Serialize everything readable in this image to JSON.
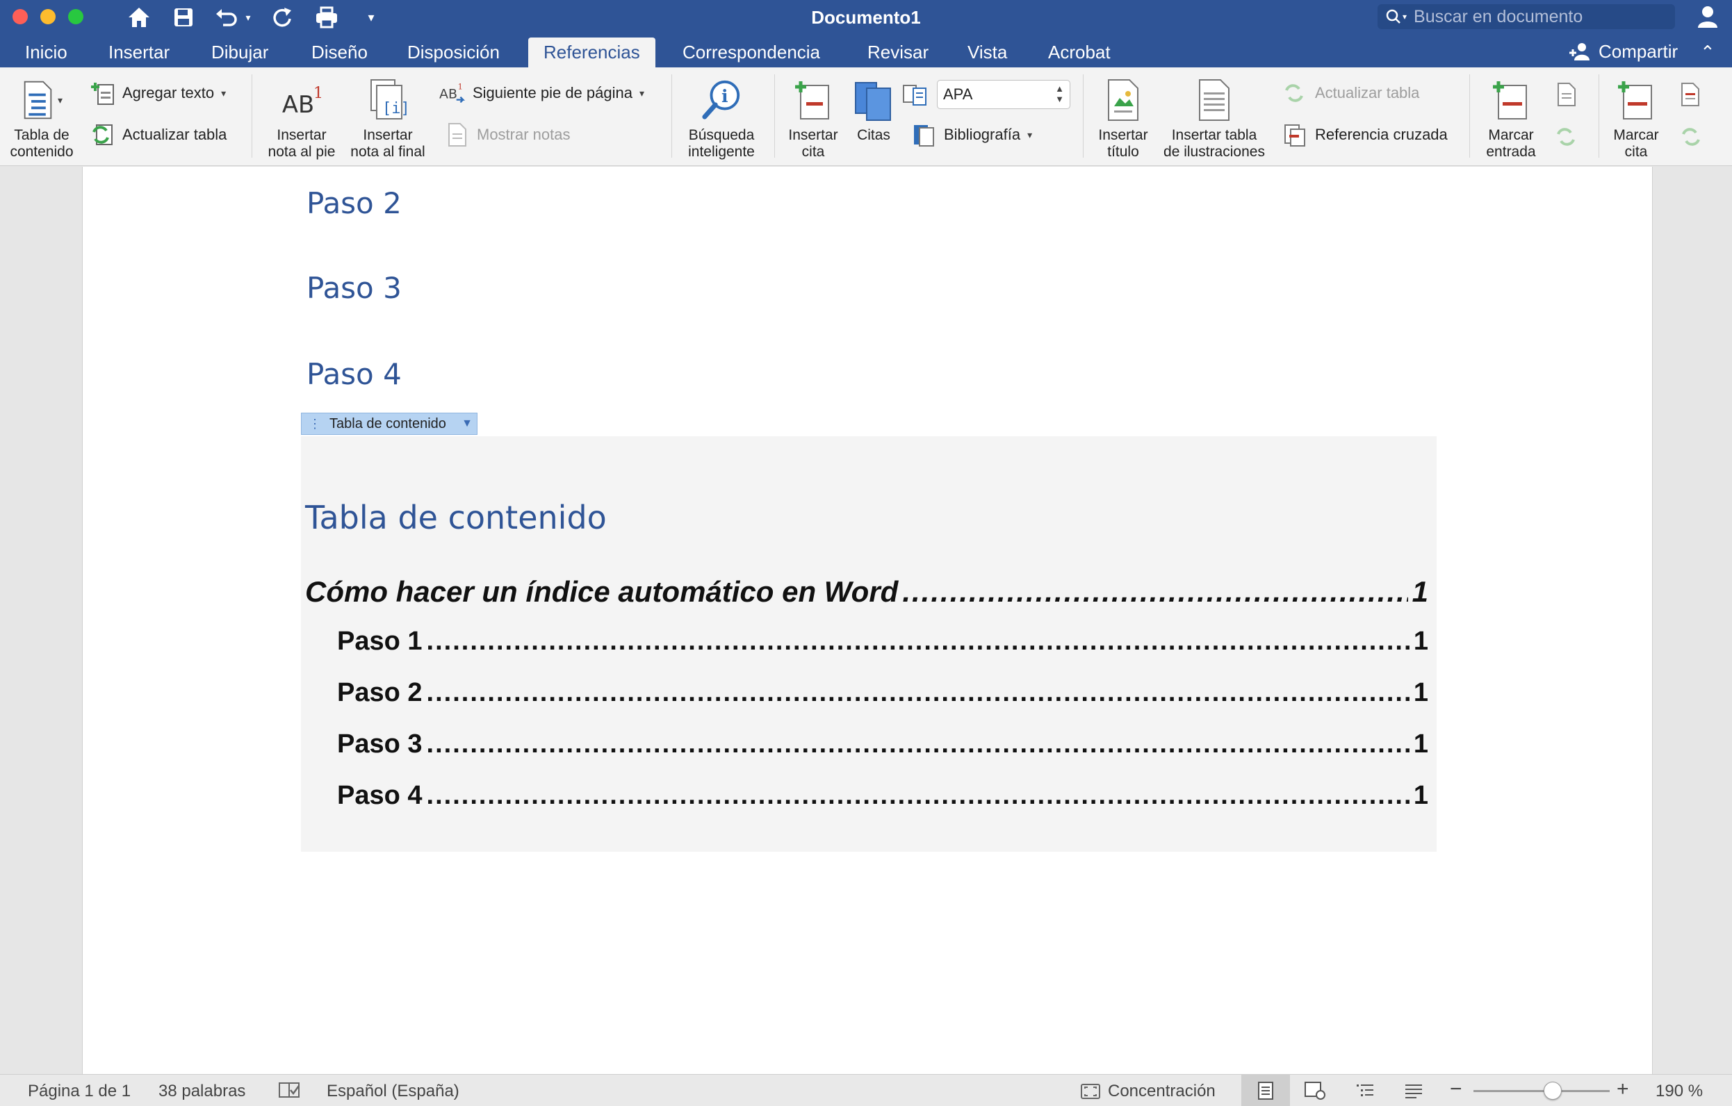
{
  "window": {
    "title": "Documento1",
    "search_placeholder": "Buscar en documento"
  },
  "tabs": [
    {
      "label": "Inicio"
    },
    {
      "label": "Insertar"
    },
    {
      "label": "Dibujar"
    },
    {
      "label": "Diseño"
    },
    {
      "label": "Disposición"
    },
    {
      "label": "Referencias",
      "active": true
    },
    {
      "label": "Correspondencia"
    },
    {
      "label": "Revisar"
    },
    {
      "label": "Vista"
    },
    {
      "label": "Acrobat"
    }
  ],
  "share_label": "Compartir",
  "ribbon": {
    "toc": {
      "line1": "Tabla de",
      "line2": "contenido"
    },
    "add_text": "Agregar texto",
    "update_table": "Actualizar tabla",
    "insert_footnote": {
      "line1": "Insertar",
      "line2": "nota al pie"
    },
    "insert_endnote": {
      "line1": "Insertar",
      "line2": "nota al final"
    },
    "next_footnote": "Siguiente pie de página",
    "show_notes": "Mostrar notas",
    "smart_lookup": {
      "line1": "Búsqueda",
      "line2": "inteligente"
    },
    "insert_citation": {
      "line1": "Insertar",
      "line2": "cita"
    },
    "citations": "Citas",
    "style_value": "APA",
    "bibliography": "Bibliografía",
    "insert_caption": {
      "line1": "Insertar",
      "line2": "título"
    },
    "insert_table_figures": {
      "line1": "Insertar tabla",
      "line2": "de ilustraciones"
    },
    "update_table_figures": "Actualizar tabla",
    "cross_reference": "Referencia cruzada",
    "mark_entry": {
      "line1": "Marcar",
      "line2": "entrada"
    },
    "mark_citation": {
      "line1": "Marcar",
      "line2": "cita"
    }
  },
  "document": {
    "headings": [
      "Paso 2",
      "Paso 3",
      "Paso 4"
    ],
    "toc_tag": "Tabla de contenido",
    "toc_title": "Tabla de contenido",
    "toc_entries": [
      {
        "text": "Cómo hacer un índice automático en Word",
        "page": "1",
        "level": 1
      },
      {
        "text": "Paso 1",
        "page": "1",
        "level": 2
      },
      {
        "text": "Paso 2",
        "page": "1",
        "level": 2
      },
      {
        "text": "Paso 3",
        "page": "1",
        "level": 2
      },
      {
        "text": "Paso 4",
        "page": "1",
        "level": 2
      }
    ]
  },
  "statusbar": {
    "page": "Página 1 de 1",
    "words": "38 palabras",
    "language": "Español (España)",
    "focus": "Concentración",
    "zoom": "190 %",
    "zoom_fraction": 0.38
  },
  "colors": {
    "accent": "#2f5496",
    "close": "#fe5f57",
    "minimize": "#febc2e",
    "maximize": "#28c840"
  }
}
